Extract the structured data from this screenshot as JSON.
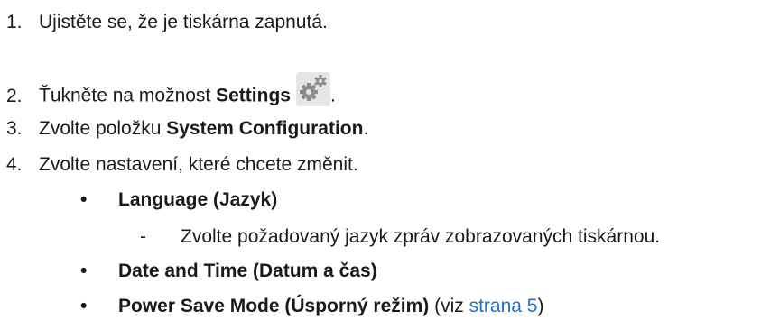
{
  "steps": [
    {
      "num": "1.",
      "text": "Ujistěte se, že je tiskárna zapnutá."
    },
    {
      "num": "2.",
      "pre": "Ťukněte na možnost ",
      "bold": "Settings",
      "post": "."
    },
    {
      "num": "3.",
      "pre": "Zvolte položku ",
      "bold": "System Configuration",
      "post": "."
    },
    {
      "num": "4.",
      "text": "Zvolte nastavení, které chcete změnit."
    }
  ],
  "settings_icon": "settings-gears-icon",
  "options": [
    {
      "bullet": "•",
      "label": "Language (Jazyk)",
      "sub": {
        "dash": "-",
        "text": "Zvolte požadovaný jazyk zpráv zobrazovaných tiskárnou."
      }
    },
    {
      "bullet": "•",
      "label": "Date and Time (Datum a čas)"
    },
    {
      "bullet": "•",
      "label": "Power Save Mode (Úsporný režim)",
      "suffix_pre": " (viz ",
      "link": "strana 5",
      "suffix_post": ")"
    }
  ],
  "colors": {
    "link": "#1f6fd1",
    "icon_bg": "#e6e6e6",
    "gear": "#8c8c8c"
  }
}
